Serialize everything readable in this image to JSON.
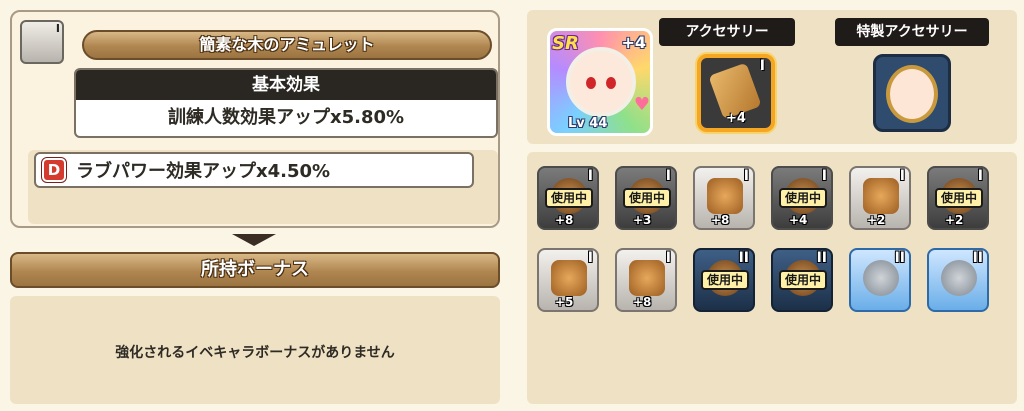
{
  "equipped_item": {
    "rank": "I",
    "name": "簡素な木のアミュレット",
    "basic_effect_header": "基本効果",
    "basic_effect_value": "訓練人数効果アップx5.80%",
    "sub_effect_grade": "D",
    "sub_effect_value": "ラブパワー効果アップx4.50%"
  },
  "bonus": {
    "title": "所持ボーナス",
    "message": "強化されるイベキャラボーナスがありません"
  },
  "character": {
    "rarity": "SR",
    "plus": "+4",
    "level": "Lv 44"
  },
  "accessory": {
    "tab_label": "アクセサリー",
    "rank": "I",
    "level": "+4"
  },
  "special_accessory": {
    "tab_label": "特製アクセサリー"
  },
  "inventory": [
    {
      "rank": "I",
      "in_use": "使用中",
      "level": "+8",
      "style": "gray"
    },
    {
      "rank": "I",
      "in_use": "使用中",
      "level": "+3",
      "style": "gray"
    },
    {
      "rank": "I",
      "in_use": "",
      "level": "+8",
      "style": "silver"
    },
    {
      "rank": "I",
      "in_use": "使用中",
      "level": "+4",
      "style": "gray"
    },
    {
      "rank": "I",
      "in_use": "",
      "level": "+2",
      "style": "silver"
    },
    {
      "rank": "I",
      "in_use": "使用中",
      "level": "+2",
      "style": "gray"
    },
    {
      "rank": "I",
      "in_use": "",
      "level": "+5",
      "style": "silver"
    },
    {
      "rank": "I",
      "in_use": "",
      "level": "+8",
      "style": "silver"
    },
    {
      "rank": "II",
      "in_use": "使用中",
      "level": "",
      "style": "blue"
    },
    {
      "rank": "II",
      "in_use": "使用中",
      "level": "",
      "style": "blue"
    },
    {
      "rank": "II",
      "in_use": "",
      "level": "",
      "style": "lightblue"
    },
    {
      "rank": "II",
      "in_use": "",
      "level": "",
      "style": "lightblue"
    }
  ]
}
